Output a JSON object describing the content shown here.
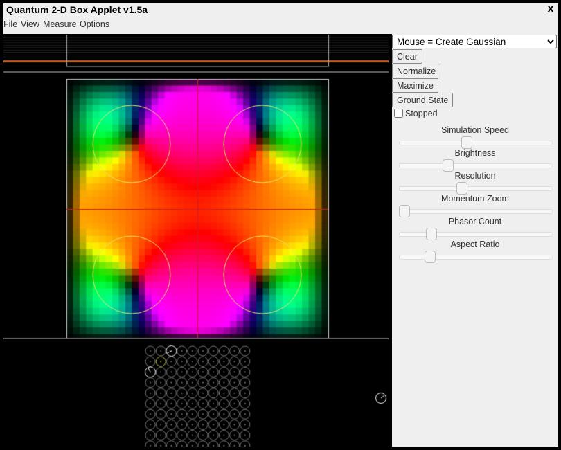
{
  "window": {
    "title": "Quantum 2-D Box Applet v1.5a",
    "close_label": "X"
  },
  "menu": {
    "items": [
      "File",
      "View",
      "Measure",
      "Options"
    ]
  },
  "controls": {
    "mode_select": {
      "selected": "Mouse = Create Gaussian"
    },
    "buttons": {
      "clear": "Clear",
      "normalize": "Normalize",
      "maximize": "Maximize",
      "ground_state": "Ground State"
    },
    "stopped": {
      "label": "Stopped",
      "checked": false
    },
    "sliders": [
      {
        "label": "Simulation Speed",
        "value_fraction": 0.44
      },
      {
        "label": "Brightness",
        "value_fraction": 0.32
      },
      {
        "label": "Resolution",
        "value_fraction": 0.41
      },
      {
        "label": "Momentum Zoom",
        "value_fraction": 0.0
      },
      {
        "label": "Phasor Count",
        "value_fraction": 0.21
      },
      {
        "label": "Aspect Ratio",
        "value_fraction": 0.2
      }
    ]
  },
  "display": {
    "phasor_grid": {
      "rows": 10,
      "cols": 10
    },
    "colors": {
      "ui_bg": "#efefef",
      "canvas_bg": "#000000",
      "measure_line": "#c8202a",
      "circle_outline": "#e6e66a",
      "energy_line_red": "#c04a2a",
      "energy_line_orange": "#d89a3a"
    }
  }
}
